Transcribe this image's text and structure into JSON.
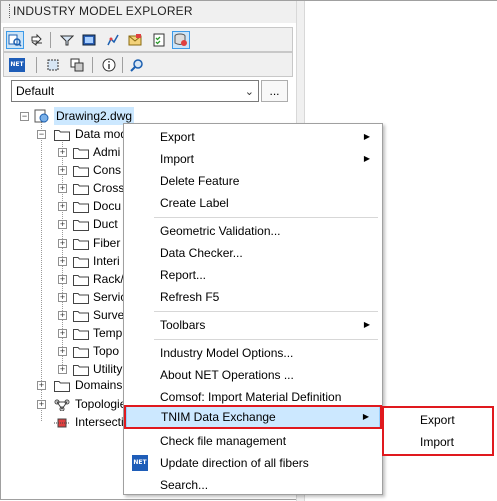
{
  "panel": {
    "title": "INDUSTRY MODEL EXPLORER"
  },
  "toolbar1": {
    "icons": [
      "explorer-icon",
      "navigate-icon",
      "filter-icon",
      "view-icon",
      "chart-icon",
      "mail-icon",
      "checklist-icon",
      "database-icon"
    ]
  },
  "toolbar2": {
    "icons": [
      "net-icon",
      "select-icon",
      "copy-icon",
      "info-icon",
      "search-icon"
    ],
    "net_text": "NET"
  },
  "dataset_combo": {
    "value": "Default",
    "browse_label": "..."
  },
  "tree": {
    "root": "Drawing2.dwg",
    "data_model": "Data mod",
    "children": [
      "Admi",
      "Cons",
      "Cross",
      "Docu",
      "Duct",
      "Fiber",
      "Interi",
      "Rack/",
      "Servic",
      "Surve",
      "Temp",
      "Topo",
      "Utility"
    ],
    "domains": "Domains",
    "topologies": "Topologie",
    "intersection": "Intersecti"
  },
  "context_menu": {
    "items": {
      "export": "Export",
      "import": "Import",
      "delete_feature": "Delete Feature",
      "create_label": "Create Label",
      "geometric_validation": "Geometric Validation...",
      "data_checker": "Data Checker...",
      "report": "Report...",
      "refresh": "Refresh F5",
      "toolbars": "Toolbars",
      "industry_model_options": "Industry Model Options...",
      "about_net": "About NET Operations ...",
      "comsof_import": "Comsof: Import Material Definition",
      "tnim_exchange": "TNIM Data Exchange",
      "check_file": "Check file management",
      "update_direction": "Update direction of all fibers",
      "search": "Search..."
    }
  },
  "submenu": {
    "export": "Export",
    "import": "Import"
  },
  "colors": {
    "highlight": "#cce8ff",
    "callout": "#e0191e",
    "net_blue": "#1e5db8"
  }
}
